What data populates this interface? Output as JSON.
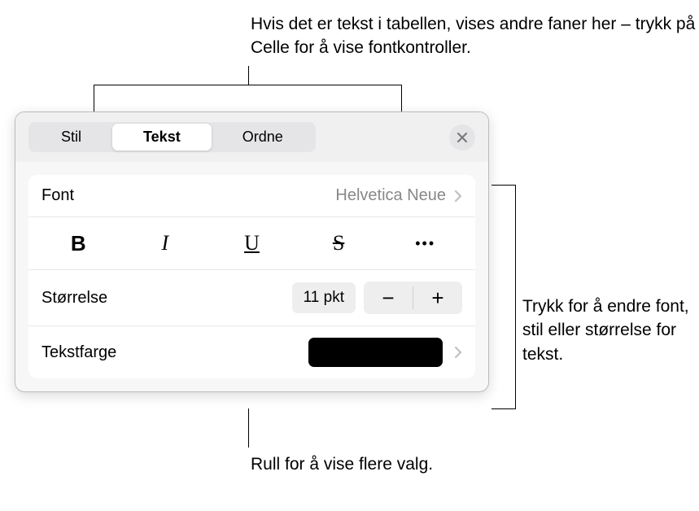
{
  "callouts": {
    "top": "Hvis det er tekst i tabellen, vises andre faner her – trykk på Celle for å vise fontkontroller.",
    "right": "Trykk for å endre font, stil eller størrelse for tekst.",
    "bottom": "Rull for å vise flere valg."
  },
  "tabs": {
    "style": "Stil",
    "text": "Tekst",
    "arrange": "Ordne"
  },
  "rows": {
    "font": {
      "label": "Font",
      "value": "Helvetica Neue"
    },
    "size": {
      "label": "Størrelse",
      "value": "11 pkt"
    },
    "color": {
      "label": "Tekstfarge",
      "value": "#000000"
    }
  },
  "styleButtons": {
    "bold": "B",
    "italic": "I",
    "underline": "U",
    "strike": "S",
    "more": "•••"
  },
  "icons": {
    "close": "close-icon",
    "chevron": "chevron-right-icon",
    "minus": "−",
    "plus": "+"
  }
}
